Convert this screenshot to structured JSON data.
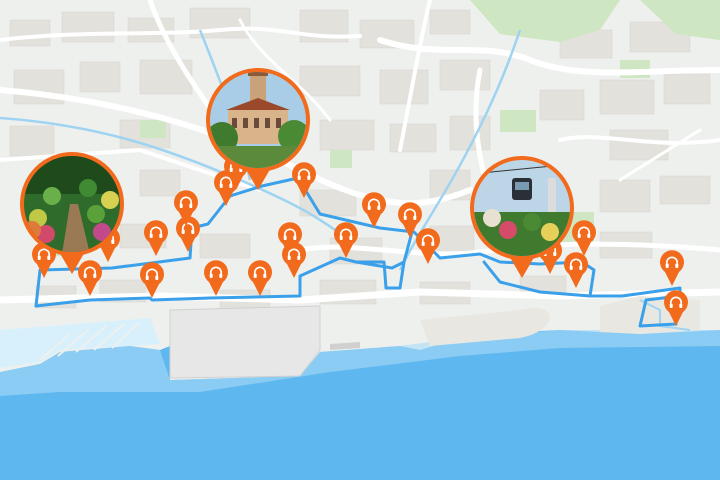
{
  "map": {
    "colors": {
      "sea": "#5fb7ef",
      "sea_light": "#a9daf8",
      "land": "#eef0ee",
      "block": "#e3e1dc",
      "park": "#cfe6c2",
      "road": "#ffffff",
      "route": "#3aa0ea",
      "pin": "#f26a1b"
    },
    "pin_icon": "headphones-icon",
    "route_name": "audio-walking-tour",
    "photo_markers": [
      {
        "name": "garden-photo-marker",
        "subject": "garden"
      },
      {
        "name": "clock-tower-photo-marker",
        "subject": "historic-building"
      },
      {
        "name": "cable-car-photo-marker",
        "subject": "cable-car"
      }
    ]
  }
}
